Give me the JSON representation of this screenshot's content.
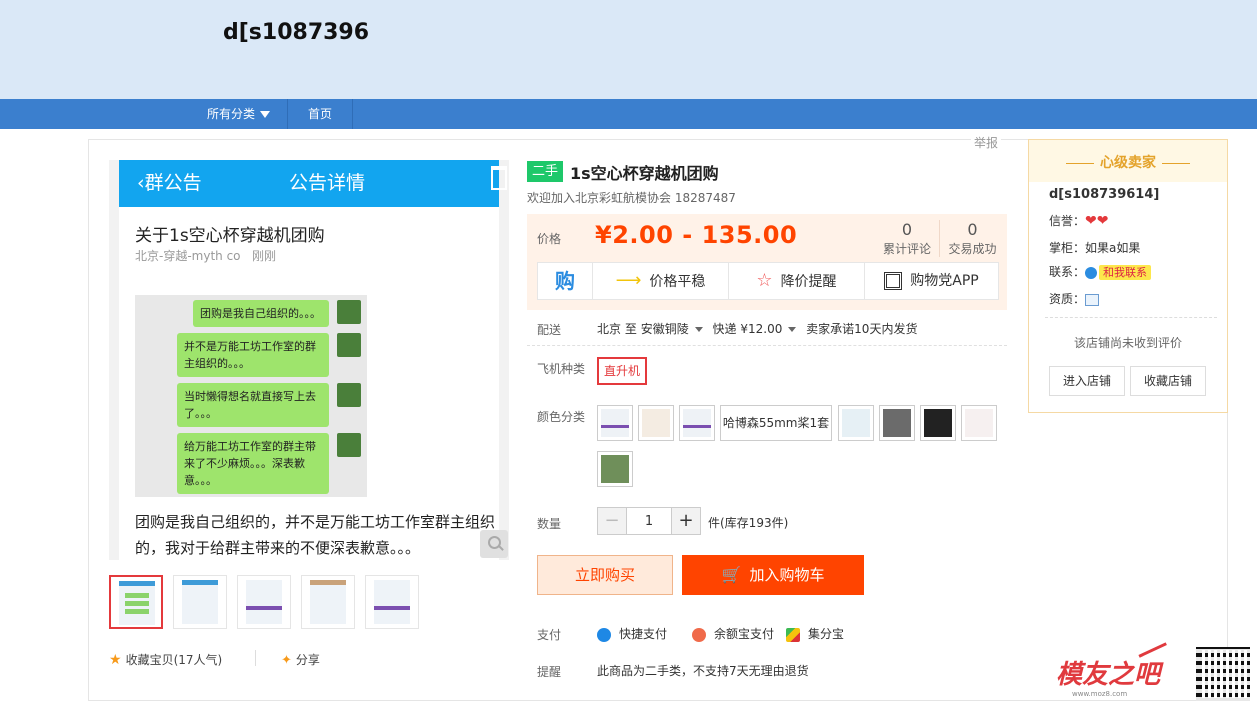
{
  "header": {
    "shop_title": "d[s1087396"
  },
  "nav": {
    "all_categories": "所有分类",
    "home": "首页"
  },
  "report": "举报",
  "gallery": {
    "phone": {
      "back_label": "群公告",
      "title": "公告详情"
    },
    "notice": {
      "title": "关于1s空心杯穿越机团购",
      "author": "北京-穿越-myth co",
      "time": "刚刚",
      "chat_messages": [
        "团购是我自己组织的。。。",
        "并不是万能工坊工作室的群主组织的。。。",
        "当时懒得想名就直接写上去了。。。",
        "给万能工坊工作室的群主带来了不少麻烦。。。深表歉意。。。"
      ],
      "body": "团购是我自己组织的，并不是万能工坊工作室群主组织的，我对于给群主带来的不便深表歉意。。。"
    },
    "thumbnails": 5,
    "favorite_label": "收藏宝贝",
    "favorite_count": "(17人气)",
    "share_label": "分享"
  },
  "product": {
    "used_badge": "二手",
    "title": "1s空心杯穿越机团购",
    "subtitle": "欢迎加入北京彩虹航模协会 18287487",
    "price_label": "价格",
    "price": "¥2.00 - 135.00",
    "reviews_count": "0",
    "reviews_label": "累计评论",
    "deals_count": "0",
    "deals_label": "交易成功",
    "features": {
      "gou": "购",
      "price_stable": "价格平稳",
      "price_alert": "降价提醒",
      "app": "购物党APP"
    },
    "shipping": {
      "label": "配送",
      "from": "北京",
      "to_word": "至",
      "to": "安徽铜陵",
      "method": "快递 ¥12.00",
      "promise": "卖家承诺10天内发货"
    },
    "aircraft_type": {
      "label": "飞机种类",
      "selected": "直升机"
    },
    "color": {
      "label": "颜色分类",
      "text_option": "哈博森55mm桨1套",
      "image_options": 9
    },
    "quantity": {
      "label": "数量",
      "value": "1",
      "stock": "件(库存193件)"
    },
    "buttons": {
      "buy_now": "立即购买",
      "add_cart": "加入购物车"
    },
    "payment": {
      "label": "支付",
      "methods": [
        "快捷支付",
        "余额宝支付",
        "集分宝"
      ]
    },
    "reminder": {
      "label": "提醒",
      "text": "此商品为二手类，不支持7天无理由退货"
    }
  },
  "seller": {
    "level": "心级卖家",
    "name": "d[s108739614]",
    "credit_label": "信誉：",
    "keeper_label": "掌柜：",
    "keeper": "如果a如果",
    "contact_label": "联系：",
    "contact_button": "和我联系",
    "license_label": "资质：",
    "no_review": "该店铺尚未收到评价",
    "enter_store": "进入店铺",
    "fav_store": "收藏店铺"
  },
  "watermark": {
    "text": "模友之吧",
    "url": "www.moz8.com"
  },
  "colors": {
    "accent": "#ff4400",
    "nav": "#3b7fce",
    "header_bg": "#dae8f7",
    "used_badge": "#1ec86a"
  }
}
